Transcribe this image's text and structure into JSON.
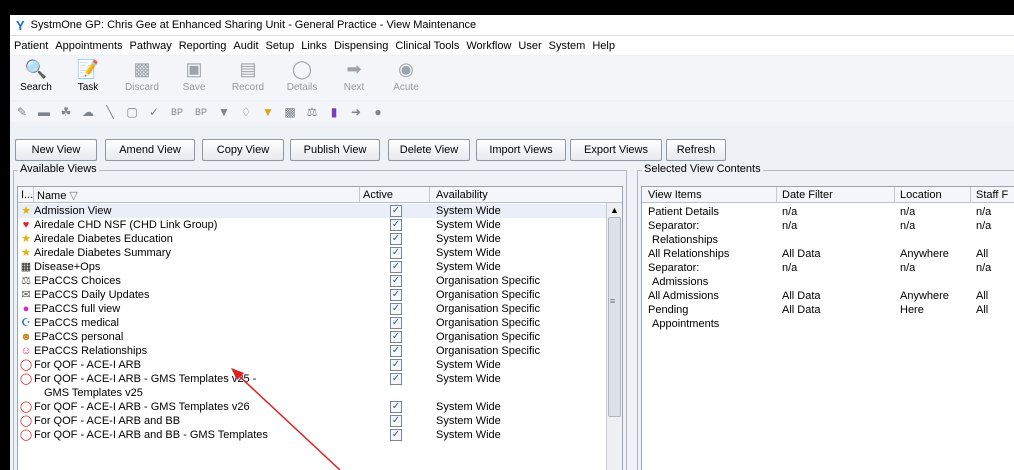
{
  "window": {
    "title": "SystmOne GP: Chris Gee at Enhanced Sharing Unit - General Practice - View Maintenance"
  },
  "menu": [
    "Patient",
    "Appointments",
    "Pathway",
    "Reporting",
    "Audit",
    "Setup",
    "Links",
    "Dispensing",
    "Clinical Tools",
    "Workflow",
    "User",
    "System",
    "Help"
  ],
  "toolbar": {
    "search": "Search",
    "task": "Task",
    "discard": "Discard",
    "save": "Save",
    "record": "Record",
    "details": "Details",
    "next": "Next",
    "acute": "Acute"
  },
  "toolbar2": {
    "bp1": "BP",
    "bp2": "BP"
  },
  "buttons": {
    "new_view": "New View",
    "amend_view": "Amend View",
    "copy_view": "Copy View",
    "publish_view": "Publish View",
    "delete_view": "Delete View",
    "import_views": "Import Views",
    "export_views": "Export Views",
    "refresh": "Refresh"
  },
  "available_views": {
    "legend": "Available Views",
    "columns": {
      "icon": "I...",
      "name": "Name",
      "active": "Active",
      "availability": "Availability"
    },
    "rows": [
      {
        "name": "Admission View",
        "availability": "System Wide",
        "icon": "star-icon",
        "active": true
      },
      {
        "name": "Airedale CHD NSF (CHD Link Group)",
        "availability": "System Wide",
        "icon": "heart-icon",
        "active": true
      },
      {
        "name": "Airedale Diabetes Education",
        "availability": "System Wide",
        "icon": "star-icon",
        "active": true
      },
      {
        "name": "Airedale Diabetes Summary",
        "availability": "System Wide",
        "icon": "star-icon",
        "active": true
      },
      {
        "name": "Disease+Ops",
        "availability": "System Wide",
        "icon": "table-icon",
        "active": true
      },
      {
        "name": "EPaCCS Choices",
        "availability": "Organisation Specific",
        "icon": "scales-icon",
        "active": true
      },
      {
        "name": "EPaCCS Daily Updates",
        "availability": "Organisation Specific",
        "icon": "envelope-icon",
        "active": true
      },
      {
        "name": "EPaCCS full view",
        "availability": "Organisation Specific",
        "icon": "circle-icon",
        "active": true
      },
      {
        "name": "EPaCCS medical",
        "availability": "Organisation Specific",
        "icon": "medical-kit-icon",
        "active": true
      },
      {
        "name": "EPaCCS personal",
        "availability": "Organisation Specific",
        "icon": "people-icon",
        "active": true
      },
      {
        "name": "EPaCCS Relationships",
        "availability": "Organisation Specific",
        "icon": "family-icon",
        "active": true
      },
      {
        "name": "For QOF - ACE-I ARB",
        "availability": "System Wide",
        "icon": "pill-icon",
        "active": true
      },
      {
        "name": "For QOF - ACE-I ARB - GMS Templates v25 -",
        "name2": "GMS Templates v25",
        "availability": "System Wide",
        "icon": "pill-icon",
        "active": true
      },
      {
        "name": "For QOF - ACE-I ARB - GMS Templates v26",
        "availability": "System Wide",
        "icon": "pill-icon",
        "active": true
      },
      {
        "name": "For QOF - ACE-I ARB and BB",
        "availability": "System Wide",
        "icon": "pill-icon",
        "active": true
      },
      {
        "name": "For QOF - ACE-I ARB and BB - GMS Templates",
        "availability": "System Wide",
        "icon": "pill-icon",
        "active": true
      }
    ]
  },
  "selected_view": {
    "legend": "Selected View Contents",
    "columns": {
      "items": "View Items",
      "date": "Date Filter",
      "location": "Location",
      "staff": "Staff F"
    },
    "rows": [
      {
        "item": "Patient Details",
        "item2": "",
        "date": "n/a",
        "location": "n/a",
        "staff": "n/a"
      },
      {
        "item": "Separator:",
        "item2": "Relationships",
        "date": "n/a",
        "location": "n/a",
        "staff": "n/a"
      },
      {
        "item": "All Relationships",
        "item2": "",
        "date": "All Data",
        "location": "Anywhere",
        "staff": "All"
      },
      {
        "item": "Separator:",
        "item2": "Admissions",
        "date": "n/a",
        "location": "n/a",
        "staff": "n/a"
      },
      {
        "item": "All Admissions",
        "item2": "",
        "date": "All Data",
        "location": "Anywhere",
        "staff": "All"
      },
      {
        "item": "Pending",
        "item2": "Appointments",
        "date": "All Data",
        "location": "Here",
        "staff": "All"
      }
    ]
  },
  "colors": {
    "annotation_arrow": "#e02020",
    "selected_row": "#e9eef8"
  }
}
